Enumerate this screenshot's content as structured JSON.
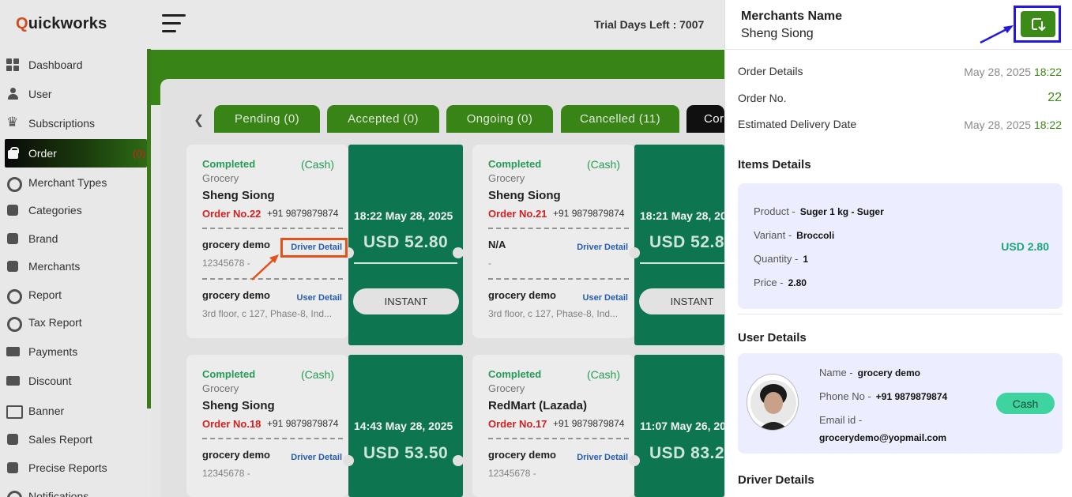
{
  "brand": {
    "logo_first": "Q",
    "logo_rest": "uickworks"
  },
  "header": {
    "trial": "Trial Days Left : 7007"
  },
  "sidebar": {
    "items": [
      {
        "label": "Dashboard",
        "icon": "dashboard-icon"
      },
      {
        "label": "User",
        "icon": "user-icon"
      },
      {
        "label": "Subscriptions",
        "icon": "crown-icon"
      },
      {
        "label": "Order",
        "icon": "shopping-bag-icon",
        "badge": "(0)",
        "active": true
      },
      {
        "label": "Merchant Types",
        "icon": "merchant-types-icon"
      },
      {
        "label": "Categories",
        "icon": "categories-icon"
      },
      {
        "label": "Brand",
        "icon": "brand-icon"
      },
      {
        "label": "Merchants",
        "icon": "merchants-icon"
      },
      {
        "label": "Report",
        "icon": "report-icon"
      },
      {
        "label": "Tax Report",
        "icon": "tax-report-icon"
      },
      {
        "label": "Payments",
        "icon": "payments-icon"
      },
      {
        "label": "Discount",
        "icon": "discount-icon"
      },
      {
        "label": "Banner",
        "icon": "banner-icon"
      },
      {
        "label": "Sales Report",
        "icon": "sales-report-icon"
      },
      {
        "label": "Precise Reports",
        "icon": "precise-reports-icon"
      },
      {
        "label": "Notifications",
        "icon": "notifications-icon"
      }
    ]
  },
  "tabs": [
    {
      "label": "Pending (0)"
    },
    {
      "label": "Accepted (0)"
    },
    {
      "label": "Ongoing (0)"
    },
    {
      "label": "Cancelled (11)"
    },
    {
      "label": "Cor"
    }
  ],
  "orders": [
    {
      "status": "Completed",
      "payment": "(Cash)",
      "category": "Grocery",
      "merchant": "Sheng Siong",
      "order_no": "Order No.22",
      "phone": "+91 9879879874",
      "driver_name": "grocery demo",
      "driver_link": "Driver Detail",
      "driver_sub": "12345678 -",
      "user_name": "grocery demo",
      "user_link": "User Detail",
      "user_addr": "3rd floor, c 127, Phase-8, Ind...",
      "datetime": "18:22 May 28, 2025",
      "amount": "USD  52.80",
      "type": "INSTANT"
    },
    {
      "status": "Completed",
      "payment": "(Cash)",
      "category": "Grocery",
      "merchant": "Sheng Siong",
      "order_no": "Order No.21",
      "phone": "+91 9879879874",
      "driver_name": "N/A",
      "driver_link": "Driver Detail",
      "driver_sub": "-",
      "user_name": "grocery demo",
      "user_link": "User Detail",
      "user_addr": "3rd floor, c 127, Phase-8, Ind...",
      "datetime": "18:21 May 28, 20",
      "amount": "USD  52.8",
      "type": "INSTANT"
    },
    {
      "status": "Completed",
      "payment": "(Cash)",
      "category": "Grocery",
      "merchant": "Sheng Siong",
      "order_no": "Order No.18",
      "phone": "+91 9879879874",
      "driver_name": "grocery demo",
      "driver_link": "Driver Detail",
      "driver_sub": "12345678 -",
      "datetime": "14:43 May 28, 2025",
      "amount": "USD  53.50"
    },
    {
      "status": "Completed",
      "payment": "(Cash)",
      "category": "Grocery",
      "merchant": "RedMart (Lazada)",
      "order_no": "Order No.17",
      "phone": "+91 9879879874",
      "driver_name": "grocery demo",
      "driver_link": "Driver Detail",
      "driver_sub": "12345678 -",
      "datetime": "11:07 May 26, 20",
      "amount": "USD  83.2"
    }
  ],
  "drawer": {
    "title": "Merchants Name",
    "merchant": "Sheng Siong",
    "order_details_label": "Order Details",
    "order_details_date": "May 28, 2025",
    "order_details_time": "18:22",
    "order_no_label": "Order No.",
    "order_no_value": "22",
    "eta_label": "Estimated Delivery Date",
    "eta_date": "May 28, 2025",
    "eta_time": "18:22",
    "items_title": "Items Details",
    "item": {
      "product_label": "Product -",
      "product": "Suger 1 kg - Suger",
      "variant_label": "Variant -",
      "variant": "Broccoli",
      "quantity_label": "Quantity -",
      "quantity": "1",
      "price_label": "Price -",
      "price": "2.80",
      "total": "USD 2.80"
    },
    "user_title": "User Details",
    "user": {
      "name_label": "Name -",
      "name": "grocery demo",
      "phone_label": "Phone No -",
      "phone": "+91 9879879874",
      "email_label": "Email id -",
      "email": "grocerydemo@yopmail.com",
      "payment": "Cash"
    },
    "driver_title": "Driver Details"
  },
  "colors": {
    "brand_green": "#3c8a17",
    "ticket_green": "#0f7a55",
    "highlight_orange": "#f0541d",
    "highlight_blue": "#2418e0"
  }
}
